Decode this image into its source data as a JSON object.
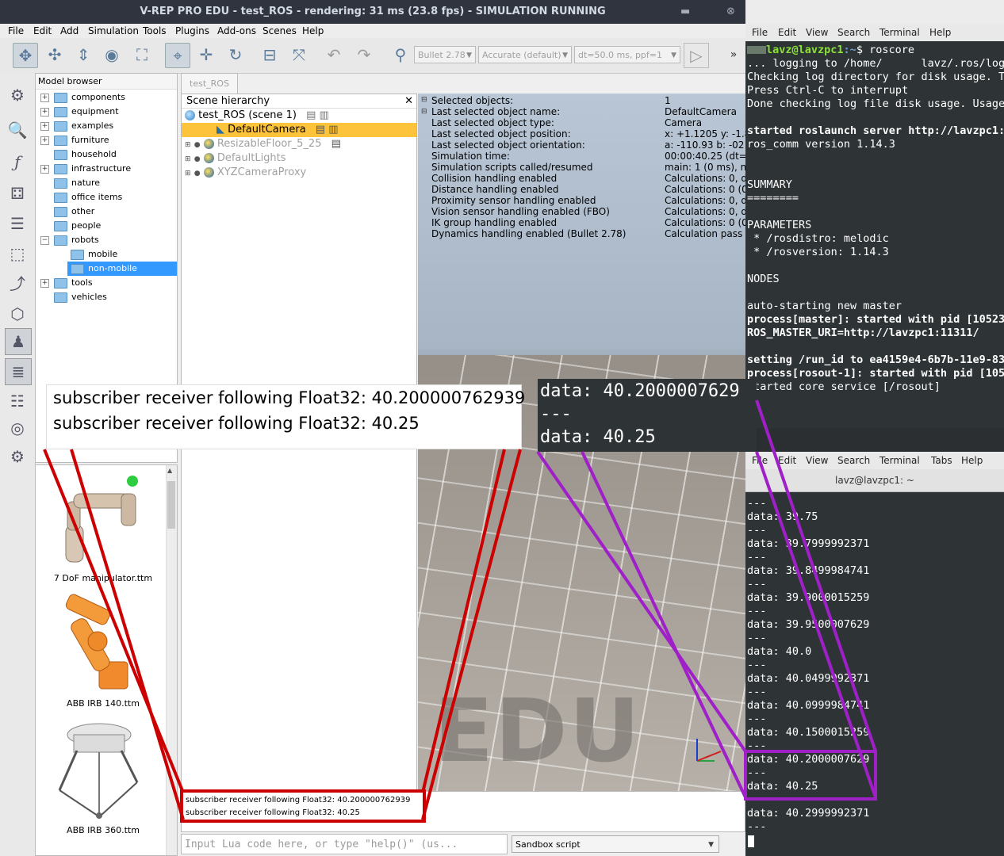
{
  "vrep": {
    "title": "V-REP PRO EDU - test_ROS - rendering: 31 ms (23.8 fps) - SIMULATION RUNNING",
    "window_buttons": {
      "minimize": "▬",
      "close": "⊗"
    },
    "menu": [
      "File",
      "Edit",
      "Add",
      "Simulation",
      "Tools",
      "Plugins",
      "Add-ons",
      "Scenes",
      "Help"
    ],
    "toolbar": {
      "physics_engine": "Bullet 2.78",
      "accuracy": "Accurate (default)",
      "timestep": "dt=50.0 ms, ppf=1",
      "more": "»"
    },
    "model_browser": {
      "title": "Model browser",
      "items": [
        {
          "label": "components",
          "expandable": true
        },
        {
          "label": "equipment",
          "expandable": true
        },
        {
          "label": "examples",
          "expandable": true
        },
        {
          "label": "furniture",
          "expandable": true
        },
        {
          "label": "household",
          "expandable": false
        },
        {
          "label": "infrastructure",
          "expandable": true
        },
        {
          "label": "nature",
          "expandable": false
        },
        {
          "label": "office items",
          "expandable": false
        },
        {
          "label": "other",
          "expandable": false
        },
        {
          "label": "people",
          "expandable": false
        },
        {
          "label": "robots",
          "expandable": true
        },
        {
          "label": "mobile",
          "expandable": false
        },
        {
          "label": "non-mobile",
          "expandable": false
        },
        {
          "label": "tools",
          "expandable": true
        },
        {
          "label": "vehicles",
          "expandable": false
        }
      ],
      "selected": "non-mobile"
    },
    "thumbnails": [
      "7 DoF manipulator.ttm",
      "ABB IRB 140.ttm",
      "ABB IRB 360.ttm"
    ],
    "scene_tab": "test_ROS",
    "hierarchy": {
      "title": "Scene hierarchy",
      "close": "✕",
      "rows": [
        "test_ROS (scene 1)",
        "DefaultCamera",
        "ResizableFloor_5_25",
        "DefaultLights",
        "XYZCameraProxy"
      ]
    },
    "info": {
      "labels": [
        "Selected objects:",
        "Last selected object name:",
        "Last selected object type:",
        "Last selected object position:",
        "Last selected object orientation:",
        "Simulation time:",
        "Simulation scripts called/resumed",
        "Collision handling enabled",
        "Distance handling enabled",
        "Proximity sensor handling enabled",
        "Vision sensor handling enabled (FBO)",
        "IK group handling enabled",
        "Dynamics handling enabled (Bullet 2.78)"
      ],
      "values": [
        "1",
        "DefaultCamera",
        "Camera",
        "x: +1.1205    y: -1.8",
        "a: -110.93    b: -02",
        "00:00:40.25 (dt=50",
        "main: 1 (0 ms), no",
        "Calculations: 0, d",
        "Calculations: 0 (0",
        "Calculations: 0, d",
        "Calculations: 0, d",
        "Calculations: 0 (0",
        "Calculation pass"
      ]
    },
    "watermark": "EDU",
    "console": [
      "subscriber receiver following Float32: 40.200000762939",
      "subscriber receiver following Float32: 40.25"
    ],
    "lua_placeholder": "Input Lua code here, or type \"help()\" (us...",
    "script_select": "Sandbox script"
  },
  "zoom_vrep": [
    "subscriber receiver following Float32: 40.200000762939",
    "subscriber receiver following Float32: 40.25"
  ],
  "zoom_term": [
    "data: 40.2000007629",
    "---",
    "data: 40.25"
  ],
  "term1": {
    "menu": [
      "File",
      "Edit",
      "View",
      "Search",
      "Terminal",
      "Help"
    ],
    "prompt_user": "lavz@lavzpc1",
    "prompt_path": ":~",
    "prompt_cmd": "$ roscore",
    "lines": [
      "... logging to /home/      lavz/.ros/log/e",
      "Checking log directory for disk usage. Th",
      "Press Ctrl-C to interrupt",
      "Done checking log file disk usage. Usage",
      "",
      "started roslaunch server http://lavzpc1:3",
      "ros_comm version 1.14.3",
      "",
      "",
      "SUMMARY",
      "========",
      "",
      "PARAMETERS",
      " * /rosdistro: melodic",
      " * /rosversion: 1.14.3",
      "",
      "NODES",
      "",
      "auto-starting new master",
      "process[master]: started with pid [10523",
      "ROS_MASTER_URI=http://lavzpc1:11311/",
      "",
      "setting /run_id to ea4159e4-6b7b-11e9-833",
      "process[rosout-1]: started with pid [1053",
      "started core service [/rosout]"
    ],
    "bold_lines": [
      5,
      19,
      20,
      22,
      23
    ]
  },
  "term2": {
    "menu": [
      "File",
      "Edit",
      "View",
      "Search",
      "Terminal",
      "Tabs",
      "Help"
    ],
    "title": "lavz@lavzpc1: ~",
    "lines": [
      "---",
      "data: 39.75",
      "---",
      "data: 39.7999992371",
      "---",
      "data: 39.8499984741",
      "---",
      "data: 39.9000015259",
      "---",
      "data: 39.9500007629",
      "---",
      "data: 40.0",
      "---",
      "data: 40.0499992371",
      "---",
      "data: 40.0999984741",
      "---",
      "data: 40.1500015259",
      "---",
      "data: 40.2000007629",
      "---",
      "data: 40.25",
      "---",
      "data: 40.2999992371",
      "---"
    ]
  },
  "colors": {
    "red_callout": "#cc0000",
    "purple_callout": "#a020c8",
    "terminal_bg": "#2e3436",
    "selection": "#3399ff",
    "hierarchy_selection": "#fdc33b"
  }
}
